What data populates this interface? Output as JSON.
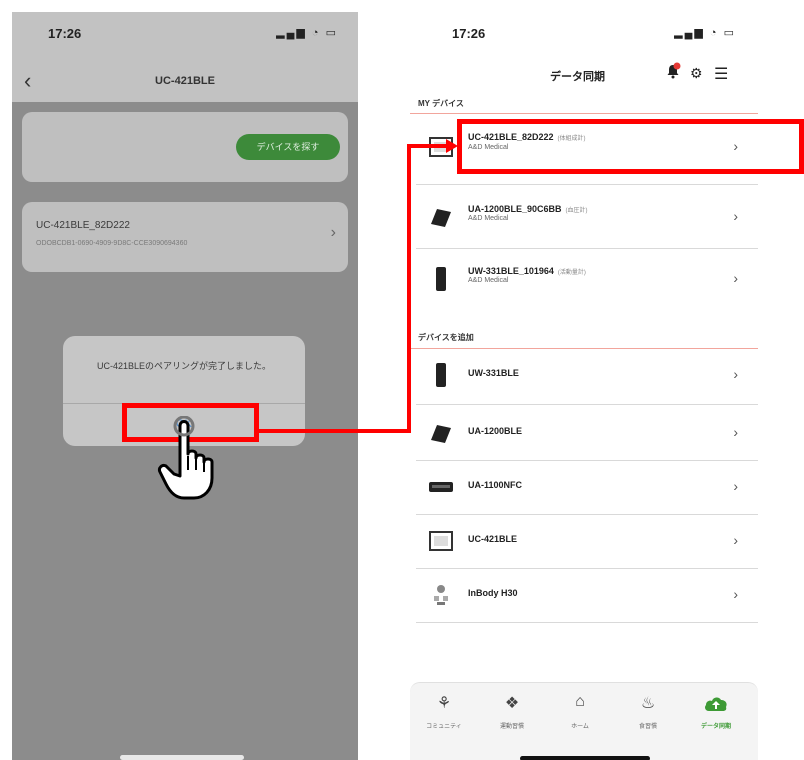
{
  "left_screen": {
    "status_time": "17:26",
    "status_icons": "▂▄▆ ◔ ▭",
    "nav_title": "UC-421BLE",
    "card1_button": "デバイスを探す",
    "device_name": "UC-421BLE_82D222",
    "device_uuid": "ODOBCDB1-0690-4909-9D8C-CCE3090694360",
    "dialog_message": "UC-421BLEのペアリングが完了しました。",
    "dialog_ok": "OK"
  },
  "right_screen": {
    "status_time": "17:26",
    "status_icons": "▂▄▆ ◔ ▭",
    "header_title": "データ同期",
    "my_devices_header": "MY デバイス",
    "add_devices_header": "デバイスを追加",
    "my_devices": [
      {
        "name": "UC-421BLE_82D222",
        "tag": "(体組成計)",
        "maker": "A&D Medical"
      },
      {
        "name": "UA-1200BLE_90C6BB",
        "tag": "(血圧計)",
        "maker": "A&D Medical"
      },
      {
        "name": "UW-331BLE_101964",
        "tag": "(活動量計)",
        "maker": "A&D Medical"
      }
    ],
    "add_devices": [
      {
        "name": "UW-331BLE"
      },
      {
        "name": "UA-1200BLE"
      },
      {
        "name": "UA-1100NFC"
      },
      {
        "name": "UC-421BLE"
      },
      {
        "name": "InBody H30"
      }
    ],
    "tabs": [
      {
        "label": "コミュニティ",
        "icon": "community-icon"
      },
      {
        "label": "運動習慣",
        "icon": "running-icon"
      },
      {
        "label": "ホーム",
        "icon": "home-icon"
      },
      {
        "label": "食習慣",
        "icon": "meal-icon"
      },
      {
        "label": "データ同期",
        "icon": "cloud-upload-icon"
      }
    ]
  },
  "colors": {
    "highlight": "#ff0000",
    "accent_green": "#3d9a35",
    "ok_blue": "#4a8fd6"
  }
}
